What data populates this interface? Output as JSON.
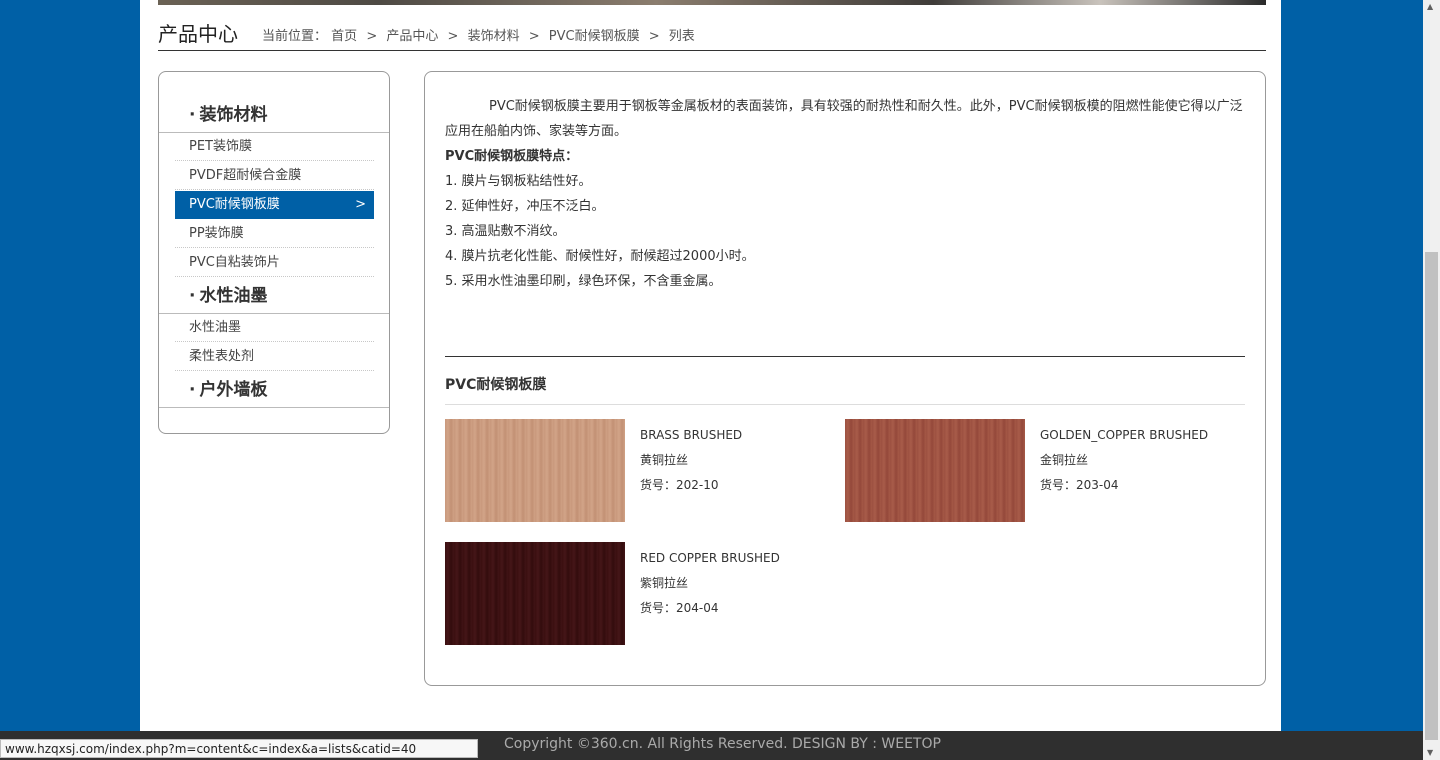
{
  "header": {
    "title": "产品中心",
    "breadcrumb_label": "当前位置：",
    "breadcrumbs": [
      "首页",
      "产品中心",
      "装饰材料",
      "PVC耐候钢板膜",
      "列表"
    ],
    "separator": ">"
  },
  "sidebar": {
    "categories": [
      {
        "label": "装饰材料",
        "items": [
          "PET装饰膜",
          "PVDF超耐候合金膜",
          "PVC耐候钢板膜",
          "PP装饰膜",
          "PVC自粘装饰片"
        ]
      },
      {
        "label": "水性油墨",
        "items": [
          "水性油墨",
          "柔性表处剂"
        ]
      },
      {
        "label": "户外墙板",
        "items": []
      }
    ],
    "active_item": "PVC耐候钢板膜",
    "arrow": ">",
    "bullet": "·"
  },
  "content": {
    "intro": "PVC耐候钢板膜主要用于钢板等金属板材的表面装饰，具有较强的耐热性和耐久性。此外，PVC耐候钢板模的阻燃性能使它得以广泛应用在船舶内饰、家装等方面。",
    "features_title": "PVC耐候钢板膜特点：",
    "features": [
      "1. 膜片与钢板粘结性好。",
      "2. 延伸性好，冲压不泛白。",
      "3. 高温贴敷不消纹。",
      "4. 膜片抗老化性能、耐候性好，耐候超过2000小时。",
      "5. 采用水性油墨印刷，绿色环保，不含重金属。"
    ],
    "section_title": "PVC耐候钢板膜",
    "products": [
      {
        "name_en": "BRASS BRUSHED",
        "name_cn": "黄铜拉丝",
        "code": "货号：202-10",
        "color": "#c8987c"
      },
      {
        "name_en": "GOLDEN_COPPER BRUSHED",
        "name_cn": "金铜拉丝",
        "code": "货号：203-04",
        "color": "#9c5040"
      },
      {
        "name_en": "RED COPPER BRUSHED",
        "name_cn": "紫铜拉丝",
        "code": "货号：204-04",
        "color": "#3a0f10"
      }
    ]
  },
  "footer": {
    "copyright": "Copyright ©360.cn. All Rights Reserved. DESIGN BY : WEETOP"
  },
  "statusbar": {
    "url": "www.hzqxsj.com/index.php?m=content&c=index&a=lists&catid=40"
  },
  "colors": {
    "brand_blue": "#0060a6",
    "footer_bg": "#2f2f2f"
  }
}
